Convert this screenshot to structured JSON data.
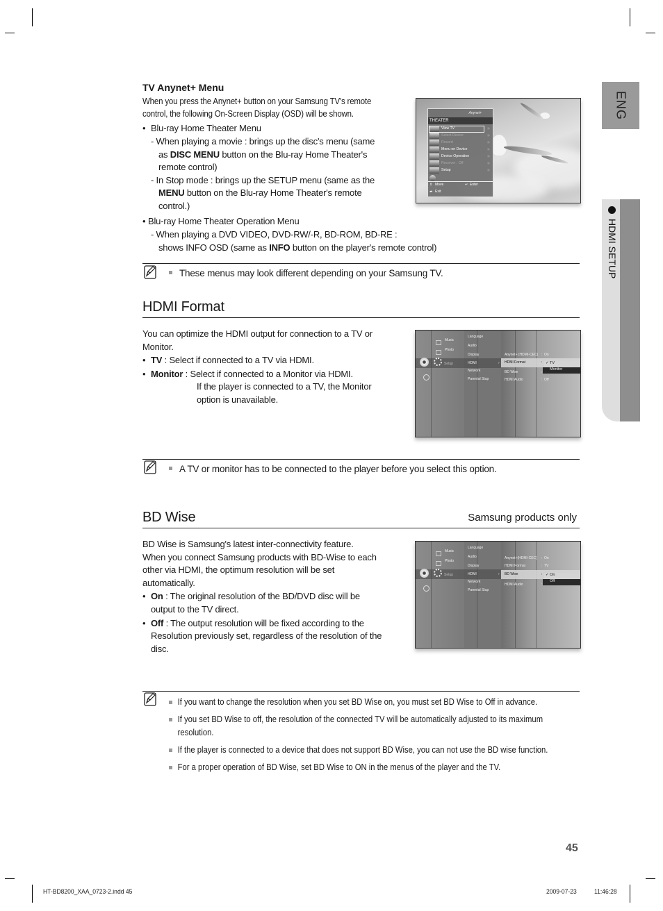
{
  "side_tabs": {
    "language": "ENG",
    "section": "HDMI SETUP"
  },
  "anynet_section": {
    "title": "TV Anynet+ Menu",
    "intro": [
      "When you press the Anynet+ button on your Samsung TV's remote",
      "control, the following On-Screen Display (OSD) will be shown."
    ],
    "items": [
      {
        "label": "Blu-ray Home Theater Menu",
        "sub": [
          {
            "lines": [
              [
                "- When playing a movie : brings up the disc's menu (same"
              ],
              [
                "as ",
                {
                  "b": "DISC MENU"
                },
                " button on the Blu-ray Home Theater's"
              ],
              [
                "remote control)"
              ]
            ]
          },
          {
            "lines": [
              [
                "- In Stop mode : brings up the SETUP menu (same as the"
              ],
              [
                {
                  "b": "MENU"
                },
                " button on the Blu-ray Home Theater's remote"
              ],
              [
                "control.)"
              ]
            ]
          }
        ]
      },
      {
        "label": "Blu-ray Home Theater Operation Menu",
        "sub": [
          {
            "lines": [
              [
                "- When playing a DVD VIDEO, DVD-RW/-R, BD-ROM, BD-RE :"
              ],
              [
                "shows INFO OSD (same as ",
                {
                  "b": "INFO"
                },
                " button on the player's remote control)"
              ]
            ]
          }
        ]
      }
    ],
    "note": "These menus may look different depending on your Samsung TV.",
    "osd": {
      "logo": "Anynet+",
      "header": "THEATER",
      "rows": [
        {
          "label": "View TV",
          "enabled": true,
          "selected": true
        },
        {
          "label": "Select Device",
          "enabled": false
        },
        {
          "label": "Record",
          "enabled": false
        },
        {
          "label": "Menu on Device",
          "enabled": true
        },
        {
          "label": "Device Operation",
          "enabled": true
        },
        {
          "label": "Receiver   : Off",
          "enabled": false
        },
        {
          "label": "Setup",
          "enabled": true
        }
      ],
      "footer": {
        "move": "Move",
        "enter": "Enter",
        "exit": "Exit"
      }
    }
  },
  "hdmi_format": {
    "heading": "HDMI Format",
    "intro": [
      "You can optimize the HDMI output for connection to a TV or",
      "Monitor."
    ],
    "bullets": [
      {
        "term": "TV",
        "text": " : Select if connected to a TV via HDMI.",
        "extra": []
      },
      {
        "term": "Monitor",
        "text": " : Select if connected to a Monitor via HDMI.",
        "extra": [
          "If the player is connected to a TV, the Monitor",
          "option is unavailable."
        ]
      }
    ],
    "note": "A TV or monitor has to be connected to the player before you select this option.",
    "screen": {
      "media": [
        "Music",
        "Photo",
        "Setup"
      ],
      "menu": [
        "Language",
        "Audio",
        "Display",
        "HDMI",
        "Network",
        "Parental Stup"
      ],
      "settings": [
        {
          "label": "Anynet+ (HDMI-CEC)",
          "value": "On"
        },
        {
          "label": "HDMI Format",
          "value": ""
        },
        {
          "label": "BD Wise",
          "value": ""
        },
        {
          "label": "HDMI Audio",
          "value": "Off"
        }
      ],
      "popup_selected": "TV",
      "popup_option": "Monitor"
    }
  },
  "bd_wise": {
    "heading": "BD Wise",
    "tag": "Samsung products only",
    "intro": [
      "BD Wise is Samsung's latest inter-connectivity feature.",
      "When you connect Samsung products with BD-Wise to each",
      "other via HDMI, the optimum resolution will be set",
      "automatically."
    ],
    "bullets": [
      {
        "term": "On",
        "lines": [
          " : The original resolution of the BD/DVD disc will be",
          "output to the TV direct."
        ]
      },
      {
        "term": "Off",
        "lines": [
          " : The output resolution will be fixed according to the",
          "Resolution previously set, regardless of the resolution of the",
          "disc."
        ]
      }
    ],
    "notes": [
      [
        "If you want to change the resolution when you set BD Wise on, you must set BD Wise to Off in advance."
      ],
      [
        "If you set BD Wise to off, the resolution of the connected TV will be automatically adjusted to its maximum",
        "resolution."
      ],
      [
        "If the player is connected to a device that does not support BD Wise, you can not use the BD wise function."
      ],
      [
        "For a proper operation of BD Wise, set BD Wise to ON in the menus of the player and the TV."
      ]
    ],
    "screen": {
      "media": [
        "Music",
        "Photo",
        "Setup"
      ],
      "menu": [
        "Language",
        "Audio",
        "Display",
        "HDMI",
        "Network",
        "Parental Stup"
      ],
      "settings": [
        {
          "label": "Anynet+(HDMI-CEC)",
          "value": "On"
        },
        {
          "label": "HDMI Format",
          "value": "TV"
        },
        {
          "label": "BD Wise",
          "value": ""
        },
        {
          "label": "HDMI Audio",
          "value": ""
        }
      ],
      "popup_selected": "On",
      "popup_option": "Off"
    }
  },
  "page_number": "45",
  "footer": {
    "file": "HT-BD8200_XAA_0723-2.indd   45",
    "date": "2009-07-23",
    "time": "11:46:28"
  }
}
